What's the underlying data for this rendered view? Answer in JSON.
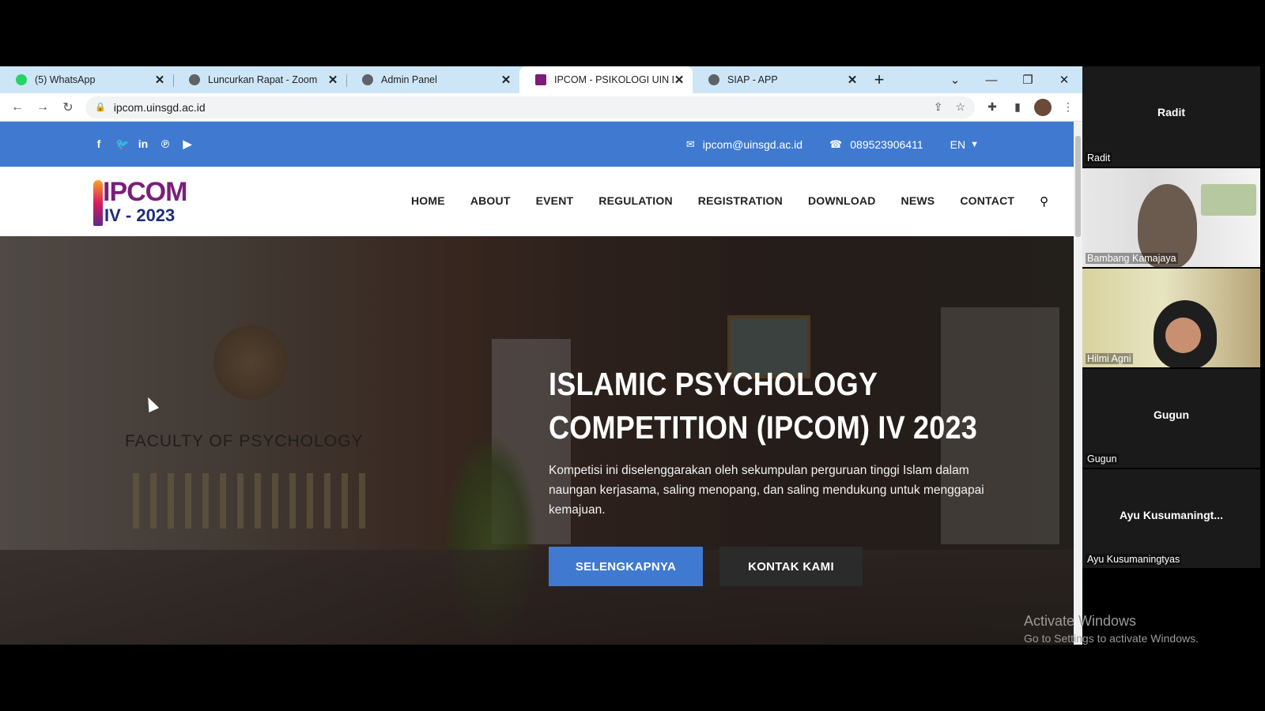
{
  "browser": {
    "tabs": [
      {
        "title": "(5) WhatsApp",
        "favicon_color": "#25d366",
        "active": false
      },
      {
        "title": "Luncurkan Rapat - Zoom",
        "favicon_color": "#5f6368",
        "active": false
      },
      {
        "title": "Admin Panel",
        "favicon_color": "#5f6368",
        "active": false
      },
      {
        "title": "IPCOM - PSIKOLOGI UIN BDG",
        "favicon_color": "#7a1e7a",
        "active": true
      },
      {
        "title": "SIAP - APP",
        "favicon_color": "#5f6368",
        "active": false
      }
    ],
    "new_tab": "+",
    "url": "ipcom.uinsgd.ac.id"
  },
  "site": {
    "topbar": {
      "socials": [
        "f",
        "t",
        "in",
        "p",
        "yt"
      ],
      "email": "ipcom@uinsgd.ac.id",
      "phone": "089523906411",
      "language": "EN"
    },
    "logo": {
      "line1": "IPCOM",
      "line2": "IV - 2023"
    },
    "menu": [
      "HOME",
      "ABOUT",
      "EVENT",
      "REGULATION",
      "REGISTRATION",
      "DOWNLOAD",
      "NEWS",
      "CONTACT"
    ],
    "hero": {
      "wall_text": "FACULTY OF PSYCHOLOGY",
      "title": "ISLAMIC PSYCHOLOGY COMPETITION (IPCOM) IV 2023",
      "text": "Kompetisi ini diselenggarakan oleh sekumpulan perguruan tinggi Islam dalam naungan kerjasama, saling menopang, dan saling mendukung untuk menggapai kemajuan.",
      "primary_button": "SELENGKAPNYA",
      "secondary_button": "KONTAK KAMI"
    },
    "colors": {
      "accent": "#3f7ad0",
      "dark_button": "#2b2b2b"
    }
  },
  "zoom": {
    "participants": [
      {
        "center_name": "Radit",
        "label": "Radit",
        "video": false
      },
      {
        "center_name": "",
        "label": "Bambang Kamajaya",
        "video": true
      },
      {
        "center_name": "",
        "label": "Hilmi Agni",
        "video": true
      },
      {
        "center_name": "Gugun",
        "label": "Gugun",
        "video": false
      },
      {
        "center_name": "Ayu  Kusumaningt...",
        "label": "Ayu Kusumaningtyas",
        "video": false
      }
    ]
  },
  "watermark": {
    "line1": "Activate Windows",
    "line2": "Go to Settings to activate Windows."
  }
}
